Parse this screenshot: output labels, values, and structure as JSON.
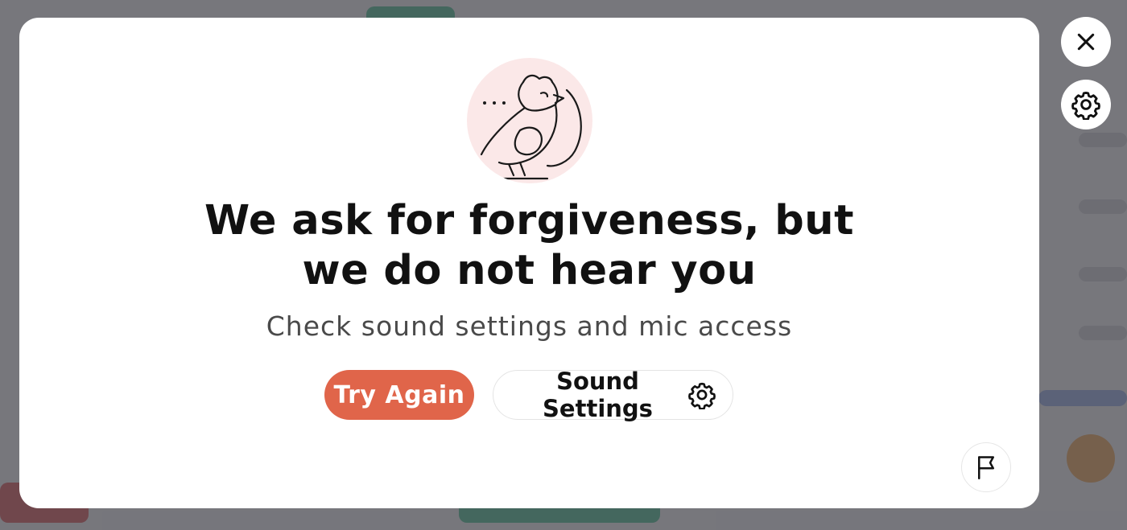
{
  "modal": {
    "title_line1": "We ask for forgiveness, but",
    "title_line2": "we do not hear you",
    "subtitle": "Check sound settings and mic access",
    "try_again_label": "Try Again",
    "sound_settings_label": "Sound Settings"
  },
  "icons": {
    "avatar": "bird-illustration-icon",
    "close": "close-icon",
    "settings": "gear-icon",
    "sound_settings": "gear-icon",
    "report": "flag-icon"
  },
  "colors": {
    "accent": "#e0654a",
    "avatar_bg": "#fbe8e8",
    "overlay": "#4a4a52",
    "text_primary": "#111111",
    "text_secondary": "#4a4a4a"
  }
}
